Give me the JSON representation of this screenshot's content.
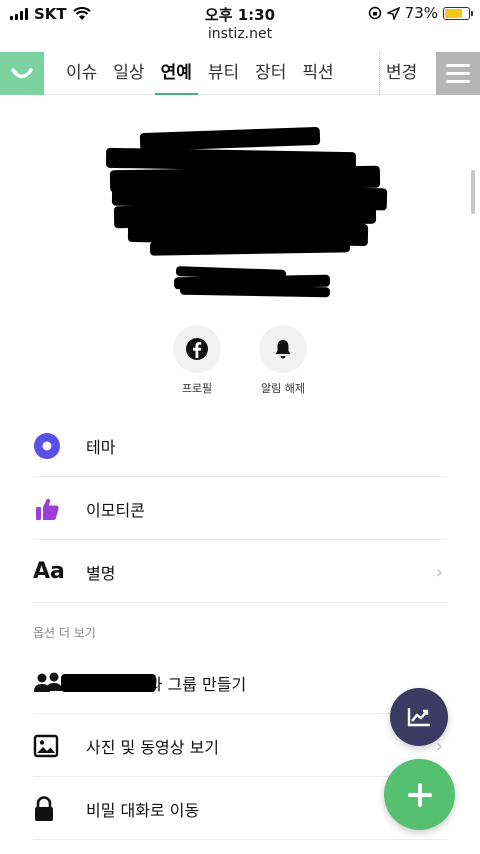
{
  "status": {
    "carrier": "SKT",
    "time": "오후 1:30",
    "battery_text": "73%",
    "battery_level": 0.73,
    "battery_color": "#f5c518"
  },
  "browser": {
    "url": "instiz.net"
  },
  "nav": {
    "tabs": [
      "이슈",
      "일상",
      "연예",
      "뷰티",
      "장터",
      "픽션"
    ],
    "active_tab": "연예",
    "change_label": "변경",
    "accent": "#3fb27f",
    "logo_color": "#7dd3a0"
  },
  "profile_actions": [
    {
      "label": "프로필",
      "icon": "facebook-icon"
    },
    {
      "label": "알림 해제",
      "icon": "bell-icon"
    }
  ],
  "menu_items": [
    {
      "label": "테마",
      "icon": "theme-icon"
    },
    {
      "label": "이모티콘",
      "icon": "thumbs-up-icon"
    },
    {
      "label": "별명",
      "icon": "text-aa-icon",
      "chevron": true
    }
  ],
  "more_options_label": "옵션 더 보기",
  "more_items": [
    {
      "label": "님과 그룹 만들기",
      "icon": "group-icon"
    },
    {
      "label": "사진 및 동영상 보기",
      "icon": "image-icon",
      "chevron": true
    },
    {
      "label": "비밀 대화로 이동",
      "icon": "lock-icon"
    }
  ],
  "icon_labels": {
    "text_aa": "Aa",
    "chevron": "›",
    "menu": "≡"
  }
}
